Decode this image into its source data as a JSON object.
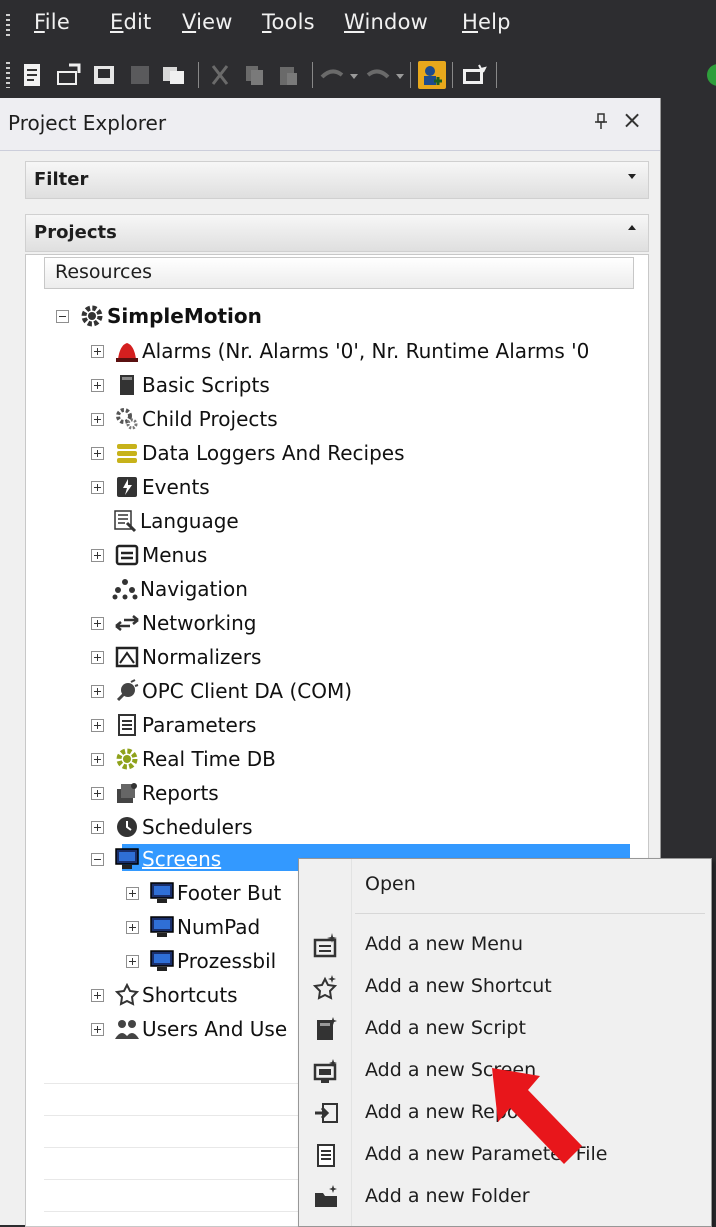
{
  "menubar": {
    "items": [
      {
        "pre": "",
        "u": "F",
        "post": "ile"
      },
      {
        "pre": "",
        "u": "E",
        "post": "dit"
      },
      {
        "pre": "",
        "u": "V",
        "post": "iew"
      },
      {
        "pre": "",
        "u": "T",
        "post": "ools"
      },
      {
        "pre": "",
        "u": "W",
        "post": "indow"
      },
      {
        "pre": "",
        "u": "H",
        "post": "elp"
      }
    ]
  },
  "panel": {
    "title": "Project Explorer",
    "pin_glyph": "ᴨ",
    "close_glyph": "×",
    "filter_label": "Filter",
    "projects_label": "Projects",
    "column_header": "Resources"
  },
  "tree": {
    "root": "SimpleMotion",
    "items": [
      "Alarms (Nr. Alarms '0', Nr. Runtime Alarms '0",
      "Basic Scripts",
      "Child Projects",
      "Data Loggers And Recipes",
      "Events",
      "Language",
      "Menus",
      "Navigation",
      "Networking",
      "Normalizers",
      "OPC Client DA (COM)",
      "Parameters",
      "Real Time DB",
      "Reports",
      "Schedulers",
      "Screens",
      "Shortcuts",
      "Users And Use"
    ],
    "screens_children": [
      "Footer But",
      "NumPad",
      "Prozessbil"
    ]
  },
  "context_menu": {
    "items": [
      "Open",
      "Add a new Menu",
      "Add a new Shortcut",
      "Add a new Script",
      "Add a new Screen",
      "Add a new Report",
      "Add a new Parameter File",
      "Add a new Folder"
    ]
  },
  "colors": {
    "selection": "#3399ff",
    "dark_chrome": "#2d2d30",
    "arrow": "#e8161b"
  }
}
